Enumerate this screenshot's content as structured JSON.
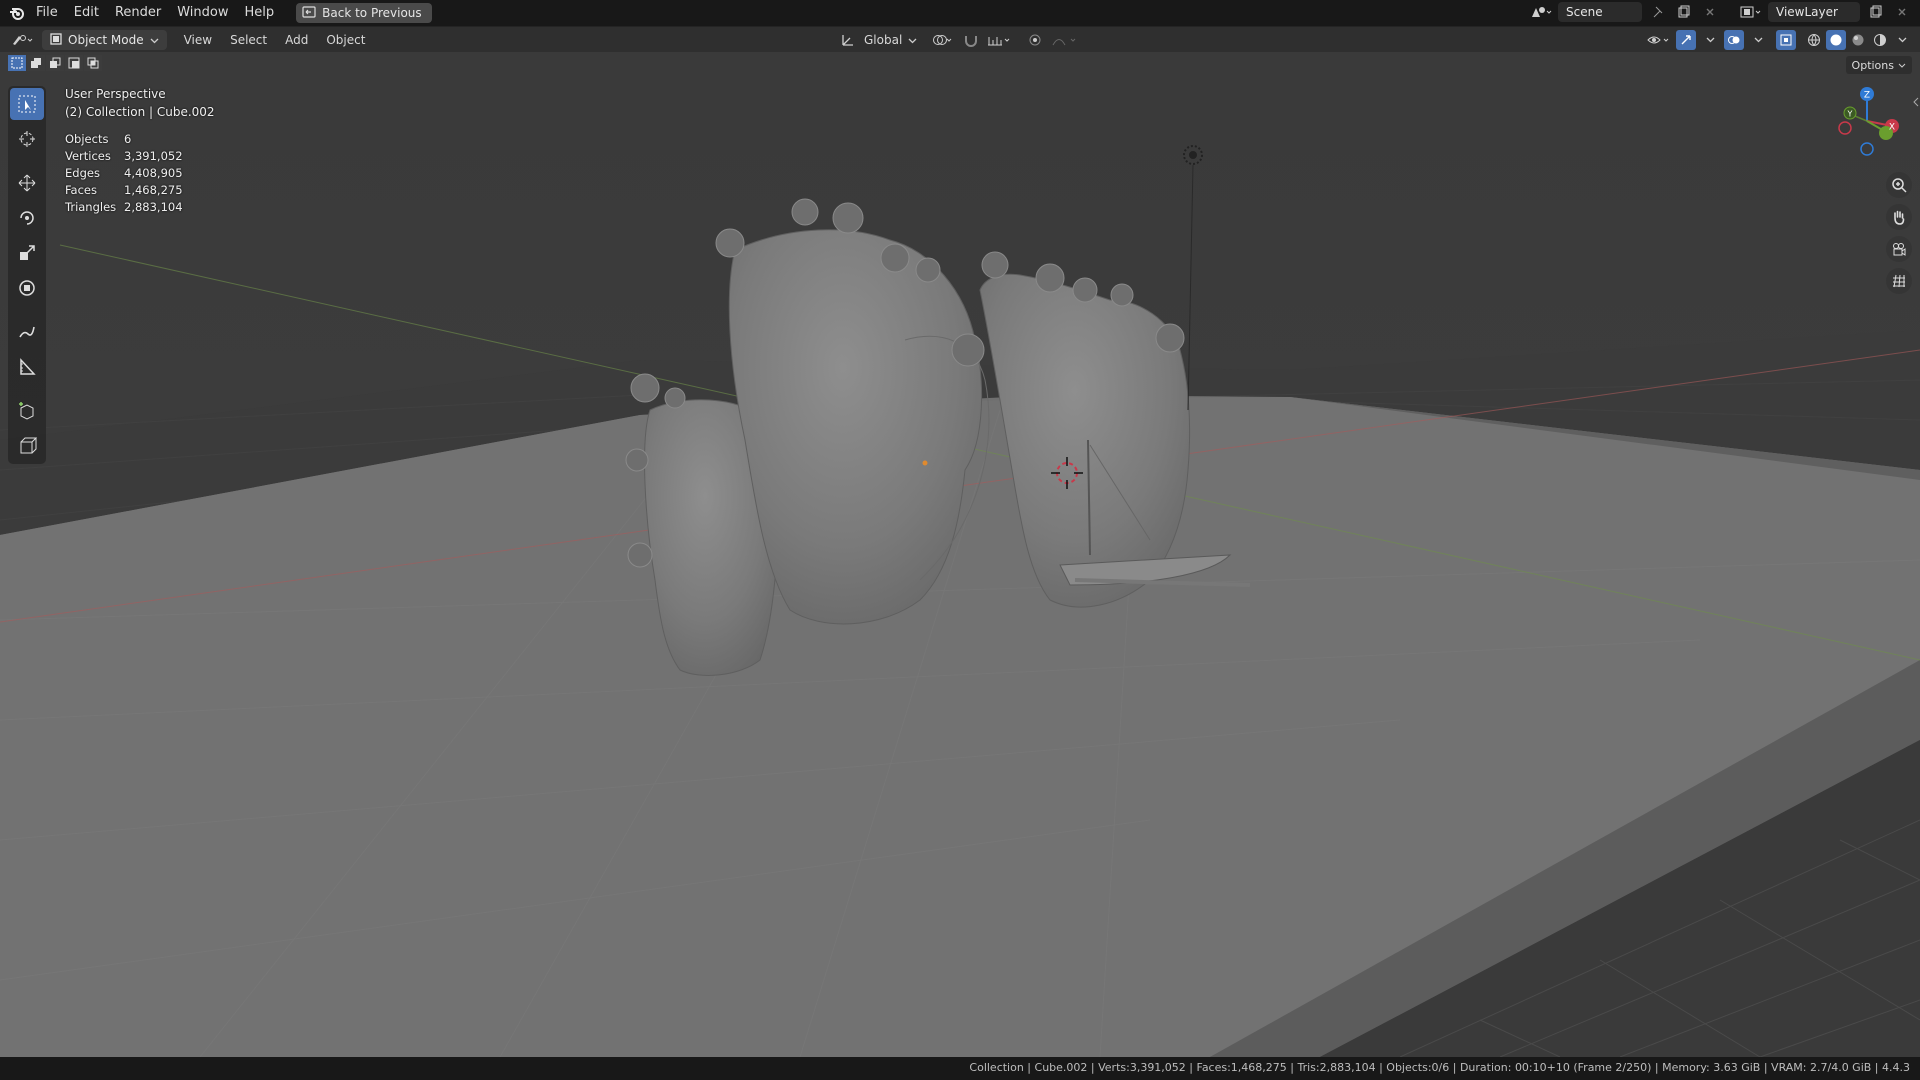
{
  "menu": {
    "items": [
      "File",
      "Edit",
      "Render",
      "Window",
      "Help"
    ],
    "back_label": "Back to Previous"
  },
  "top_right": {
    "scene": "Scene",
    "view_layer": "ViewLayer"
  },
  "header": {
    "mode": "Object Mode",
    "items": [
      "View",
      "Select",
      "Add",
      "Object"
    ],
    "transform_orientation": "Global",
    "options_label": "Options"
  },
  "viewport": {
    "perspective": "User Perspective",
    "collection_line": "(2) Collection | Cube.002",
    "stats": [
      {
        "label": "Objects",
        "value": "6"
      },
      {
        "label": "Vertices",
        "value": "3,391,052"
      },
      {
        "label": "Edges",
        "value": "4,408,905"
      },
      {
        "label": "Faces",
        "value": "1,468,275"
      },
      {
        "label": "Triangles",
        "value": "2,883,104"
      }
    ]
  },
  "gizmo": {
    "z": "Z",
    "y": "Y",
    "x": "X"
  },
  "status": {
    "text": "Collection | Cube.002 | Verts:3,391,052 | Faces:1,468,275 | Tris:2,883,104 | Objects:0/6 | Duration: 00:10+10 (Frame 2/250) | Memory: 3.63 GiB | VRAM: 2.7/4.0 GiB | 4.4.3"
  },
  "colors": {
    "accent": "#4772b3",
    "x_axis": "#c8394a",
    "y_axis": "#6a9e2e",
    "z_axis": "#2f7bd6"
  }
}
